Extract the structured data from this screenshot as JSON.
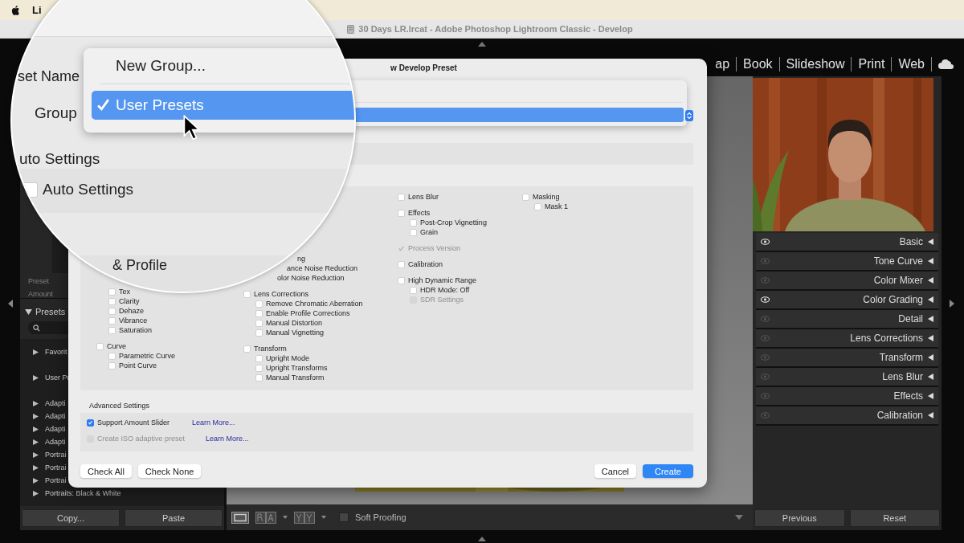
{
  "menu_bar": {
    "app": "Li"
  },
  "window": {
    "title": "30 Days LR.lrcat - Adobe Photoshop Lightroom Classic - Develop"
  },
  "modules": [
    "ap",
    "Book",
    "Slideshow",
    "Print",
    "Web"
  ],
  "left_panel": {
    "faint_labels": [
      "Preset",
      "Amount"
    ],
    "presets_header": "Presets",
    "presets": [
      {
        "label": "Favorit"
      },
      {
        "label": "User Pr"
      },
      {
        "label": "Adapti"
      },
      {
        "label": "Adapti"
      },
      {
        "label": "Adapti"
      },
      {
        "label": "Adapti"
      },
      {
        "label": "Portrai"
      },
      {
        "label": "Portrai"
      },
      {
        "label": "Portrai"
      },
      {
        "label": "Portraits: Black & White"
      }
    ],
    "buttons": [
      "Copy...",
      "Paste"
    ]
  },
  "toolbar": {
    "soft_proofing": {
      "label": "Soft Proofing",
      "checked": false
    }
  },
  "right_panel": {
    "panels": [
      {
        "label": "Basic",
        "active": true
      },
      {
        "label": "Tone Curve",
        "active": false
      },
      {
        "label": "Color Mixer",
        "active": false
      },
      {
        "label": "Color Grading",
        "active": true
      },
      {
        "label": "Detail",
        "active": false
      },
      {
        "label": "Lens Corrections",
        "active": false
      },
      {
        "label": "Transform",
        "active": false
      },
      {
        "label": "Lens Blur",
        "active": false
      },
      {
        "label": "Effects",
        "active": false
      },
      {
        "label": "Calibration",
        "active": false
      }
    ],
    "buttons": [
      "Previous",
      "Reset"
    ]
  },
  "dialog": {
    "title": "w Develop Preset",
    "columns": [
      [
        {
          "kind": "item",
          "label": "Tex",
          "checked": false,
          "disabled": false
        },
        {
          "kind": "item",
          "label": "Clarity",
          "checked": false,
          "disabled": false
        },
        {
          "kind": "item",
          "label": "Dehaze",
          "checked": false,
          "disabled": false
        },
        {
          "kind": "item",
          "label": "Vibrance",
          "checked": false,
          "disabled": false
        },
        {
          "kind": "item",
          "label": "Saturation",
          "checked": false,
          "disabled": false
        },
        {
          "kind": "group",
          "label": "Curve",
          "checked": false,
          "disabled": false
        },
        {
          "kind": "item",
          "label": "Parametric Curve",
          "checked": false,
          "disabled": false
        },
        {
          "kind": "item",
          "label": "Point Curve",
          "checked": false,
          "disabled": false
        }
      ],
      [
        {
          "kind": "partial",
          "label": "ng"
        },
        {
          "kind": "partial",
          "label": "ance Noise Reduction"
        },
        {
          "kind": "partial",
          "label": "olor Noise Reduction"
        },
        {
          "kind": "group",
          "label": "Lens Corrections",
          "checked": false,
          "disabled": false
        },
        {
          "kind": "item",
          "label": "Remove Chromatic Aberration",
          "checked": false,
          "disabled": false
        },
        {
          "kind": "item",
          "label": "Enable Profile Corrections",
          "checked": false,
          "disabled": false
        },
        {
          "kind": "item",
          "label": "Manual Distortion",
          "checked": false,
          "disabled": false
        },
        {
          "kind": "item",
          "label": "Manual Vignetting",
          "checked": false,
          "disabled": false
        },
        {
          "kind": "group",
          "label": "Transform",
          "checked": false,
          "disabled": false
        },
        {
          "kind": "item",
          "label": "Upright Mode",
          "checked": false,
          "disabled": false
        },
        {
          "kind": "item",
          "label": "Upright Transforms",
          "checked": false,
          "disabled": false
        },
        {
          "kind": "item",
          "label": "Manual Transform",
          "checked": false,
          "disabled": false
        }
      ],
      [
        {
          "kind": "group",
          "label": "Lens Blur",
          "checked": false,
          "disabled": false
        },
        {
          "kind": "group",
          "label": "Effects",
          "checked": false,
          "disabled": false
        },
        {
          "kind": "item",
          "label": "Post-Crop Vignetting",
          "checked": false,
          "disabled": false
        },
        {
          "kind": "item",
          "label": "Grain",
          "checked": false,
          "disabled": false
        },
        {
          "kind": "group",
          "label": "Process Version",
          "checked": true,
          "disabled": true
        },
        {
          "kind": "group",
          "label": "Calibration",
          "checked": false,
          "disabled": false
        },
        {
          "kind": "group",
          "label": "High Dynamic Range",
          "checked": false,
          "disabled": false
        },
        {
          "kind": "item",
          "label": "HDR Mode: Off",
          "checked": false,
          "disabled": false
        },
        {
          "kind": "item",
          "label": "SDR Settings",
          "checked": false,
          "disabled": true
        }
      ],
      [
        {
          "kind": "group",
          "label": "Masking",
          "checked": false,
          "disabled": false
        },
        {
          "kind": "item",
          "label": "Mask 1",
          "checked": false,
          "disabled": false
        }
      ]
    ],
    "advanced": {
      "title": "Advanced Settings",
      "rows": [
        {
          "label": "Support Amount Slider",
          "checked": true,
          "disabled": false,
          "link": "Learn More..."
        },
        {
          "label": "Create ISO adaptive preset",
          "checked": false,
          "disabled": true,
          "link": "Learn More..."
        }
      ]
    },
    "left_buttons": [
      "Check All",
      "Check None"
    ],
    "cancel": "Cancel",
    "create": "Create"
  },
  "magnifier": {
    "name_label": "set Name",
    "group_label": "Group",
    "menu": [
      {
        "label": "New Group...",
        "selected": false
      },
      {
        "label": "User Presets",
        "selected": true
      }
    ],
    "auto_heading": "uto Settings",
    "auto_settings": {
      "label": "Auto Settings",
      "checked": false
    },
    "section_heading": "& Profile"
  }
}
